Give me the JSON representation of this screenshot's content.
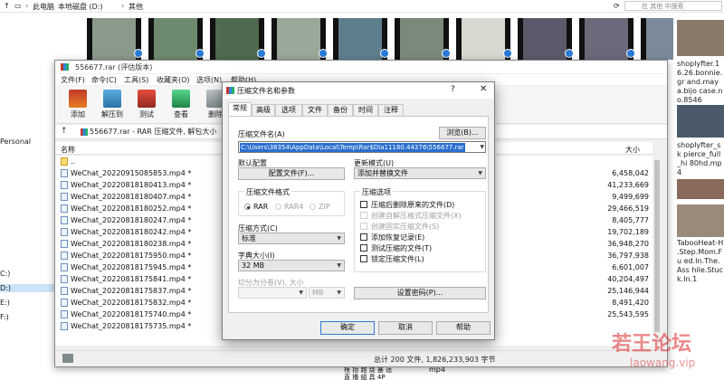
{
  "explorer": {
    "breadcrumbs": [
      "此电脑",
      "本地磁盘 (D:)",
      "其他"
    ],
    "search_placeholder": "在 其他 中搜索",
    "left_items": [
      "Personal",
      "C:)",
      "D:)",
      "E:)",
      "F:)"
    ],
    "side_files": [
      "shoplyfter.16.26.bonnie.gr and.maya.bijo case.no.8546",
      "shoplyfter_sk pierce_full_hi 80hd.mp4",
      "TabooHeat-H .Step.Mom.Fu ed.In.The.Ass hile.Stuck.In.1"
    ],
    "bottom_overflow": "mp4",
    "bottom_texts": [
      "根   抬   越   烧   蹇   适   ",
      "直 播 組 具 4P"
    ]
  },
  "rar": {
    "title": "556677.rar (评估版本)",
    "menu": [
      "文件(F)",
      "命令(C)",
      "工具(S)",
      "收藏夹(O)",
      "选项(N)",
      "帮助(H)"
    ],
    "toolbar": [
      "添加",
      "解压到",
      "测试",
      "查看",
      "删除"
    ],
    "path": "556677.rar - RAR 压缩文件, 解包大小",
    "columns": {
      "name": "名称",
      "size": "大小"
    },
    "parent_dir": "..",
    "files": [
      {
        "name": "WeChat_20220915085853.mp4 *",
        "size": "6,458,042"
      },
      {
        "name": "WeChat_20220818180413.mp4 *",
        "size": "41,233,669"
      },
      {
        "name": "WeChat_20220818180407.mp4 *",
        "size": "9,499,699"
      },
      {
        "name": "WeChat_20220818180252.mp4 *",
        "size": "29,466,519"
      },
      {
        "name": "WeChat_20220818180247.mp4 *",
        "size": "8,405,777"
      },
      {
        "name": "WeChat_20220818180242.mp4 *",
        "size": "19,702,189"
      },
      {
        "name": "WeChat_20220818180238.mp4 *",
        "size": "36,948,270"
      },
      {
        "name": "WeChat_20220818175950.mp4 *",
        "size": "36,797,938"
      },
      {
        "name": "WeChat_20220818175945.mp4 *",
        "size": "6,601,007"
      },
      {
        "name": "WeChat_20220818175841.mp4 *",
        "size": "40,204,497"
      },
      {
        "name": "WeChat_20220818175837.mp4 *",
        "size": "25,146,944"
      },
      {
        "name": "WeChat_20220818175832.mp4 *",
        "size": "8,491,420"
      },
      {
        "name": "WeChat_20220818175740.mp4 *",
        "size": "25,543,595"
      },
      {
        "name": "WeChat_20220818175735.mp4 *",
        "size": ""
      }
    ],
    "status": "总计 200 文件, 1,826,233,903 字节"
  },
  "dialog": {
    "title": "压缩文件名和参数",
    "help_glyph": "?",
    "close_glyph": "✕",
    "tabs": [
      "常规",
      "高级",
      "选项",
      "文件",
      "备份",
      "时间",
      "注释"
    ],
    "archive_name_label": "压缩文件名(A)",
    "browse_button": "浏览(B)...",
    "archive_name_value": "C:\\Users\\38354\\AppData\\Local\\Temp\\Rar$DIa11180.44376\\556677.rar",
    "default_profile_label": "默认配置",
    "profiles_button": "配置文件(F)...",
    "update_mode_label": "更新模式(U)",
    "update_mode_value": "添加并替换文件",
    "format_group": "压缩文件格式",
    "formats": [
      "RAR",
      "RAR4",
      "ZIP"
    ],
    "method_label": "压缩方式(C)",
    "method_value": "标准",
    "dict_label": "字典大小(I)",
    "dict_value": "32 MB",
    "split_label": "切分为分卷(V), 大小",
    "split_unit": "MB",
    "options_group": "压缩选项",
    "options": [
      {
        "label": "压缩后删除原来的文件(D)",
        "dim": false
      },
      {
        "label": "创建自解压格式压缩文件(X)",
        "dim": true
      },
      {
        "label": "创建固实压缩文件(S)",
        "dim": true
      },
      {
        "label": "添加恢复记录(E)",
        "dim": false
      },
      {
        "label": "测试压缩的文件(T)",
        "dim": false
      },
      {
        "label": "锁定压缩文件(L)",
        "dim": false
      }
    ],
    "password_button": "设置密码(P)...",
    "ok": "确定",
    "cancel": "取消",
    "help": "帮助"
  },
  "watermark": {
    "main": "若王论坛",
    "url": "laowang.vip"
  },
  "colors": {
    "accent": "#2b6fcf",
    "watermark": "#dc2828"
  }
}
